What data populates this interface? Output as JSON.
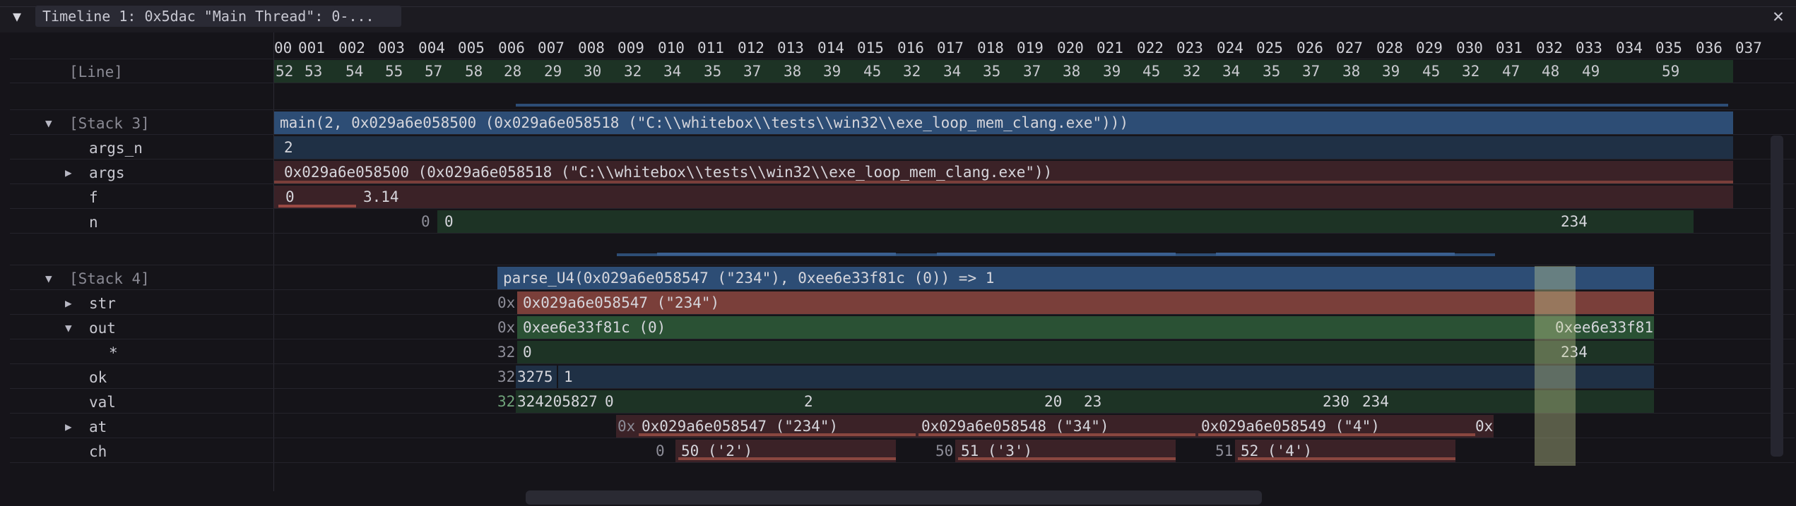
{
  "titlebar": {
    "tab_title": "Timeline 1: 0x5dac \"Main Thread\": 0-...",
    "menu_icon": "hamburger-menu-icon",
    "close_icon": "close-icon"
  },
  "ticks": [
    "00",
    "001",
    "002",
    "003",
    "004",
    "005",
    "006",
    "007",
    "008",
    "009",
    "010",
    "011",
    "012",
    "013",
    "014",
    "015",
    "016",
    "017",
    "018",
    "019",
    "020",
    "021",
    "022",
    "023",
    "024",
    "025",
    "026",
    "027",
    "028",
    "029",
    "030",
    "031",
    "032",
    "033",
    "034",
    "035",
    "036",
    "037"
  ],
  "line_label": "[Line]",
  "line_values": [
    "52",
    "53",
    "54",
    "55",
    "57",
    "58",
    "28",
    "29",
    "30",
    "32",
    "34",
    "35",
    "37",
    "38",
    "39",
    "45",
    "32",
    "34",
    "35",
    "37",
    "38",
    "39",
    "45",
    "32",
    "34",
    "35",
    "37",
    "38",
    "39",
    "45",
    "32",
    "47",
    "48",
    "49",
    "59"
  ],
  "stack3": {
    "label": "[Stack 3]",
    "call": "main(2, 0x029a6e058500 (0x029a6e058518 (\"C:\\\\whitebox\\\\tests\\\\win32\\\\exe_loop_mem_clang.exe\")))",
    "vars": [
      {
        "name": "args_n",
        "values": [
          "2"
        ]
      },
      {
        "name": "args",
        "values": [
          "0x029a6e058500 (0x029a6e058518 (\"C:\\\\whitebox\\\\tests\\\\win32\\\\exe_loop_mem_clang.exe\"))"
        ]
      },
      {
        "name": "f",
        "values": [
          "0",
          "3.14"
        ]
      },
      {
        "name": "n",
        "values": [
          "0",
          "0",
          "234"
        ]
      }
    ]
  },
  "stack4": {
    "label": "[Stack 4]",
    "call": "parse_U4(0x029a6e058547 (\"234\"), 0xee6e33f81c (0)) => 1",
    "vars": [
      {
        "name": "str",
        "values": [
          "0x",
          "0x029a6e058547 (\"234\")"
        ]
      },
      {
        "name": "out",
        "values": [
          "0x",
          "0xee6e33f81c (0)",
          "0xee6e33f81"
        ]
      },
      {
        "name": "*",
        "values": [
          "32",
          "0",
          "234"
        ]
      },
      {
        "name": "ok",
        "values": [
          "32",
          "3275",
          "1"
        ]
      },
      {
        "name": "val",
        "values": [
          "32",
          "324205827",
          "0",
          "2",
          "20",
          "23",
          "230",
          "234"
        ]
      },
      {
        "name": "at",
        "values": [
          "0x",
          "0x029a6e058547 (\"234\")",
          "0x029a6e058548 (\"34\")",
          "0x029a6e058549 (\"4\")",
          "0x"
        ]
      },
      {
        "name": "ch",
        "values": [
          "0",
          "50 ('2')",
          "50",
          "51 ('3')",
          "51",
          "52 ('4')"
        ]
      }
    ]
  },
  "colors": {
    "call_blue": "#2d4d75",
    "pointer_red": "#7a3f3a",
    "value_green": "#2a5134",
    "background": "#151419"
  }
}
